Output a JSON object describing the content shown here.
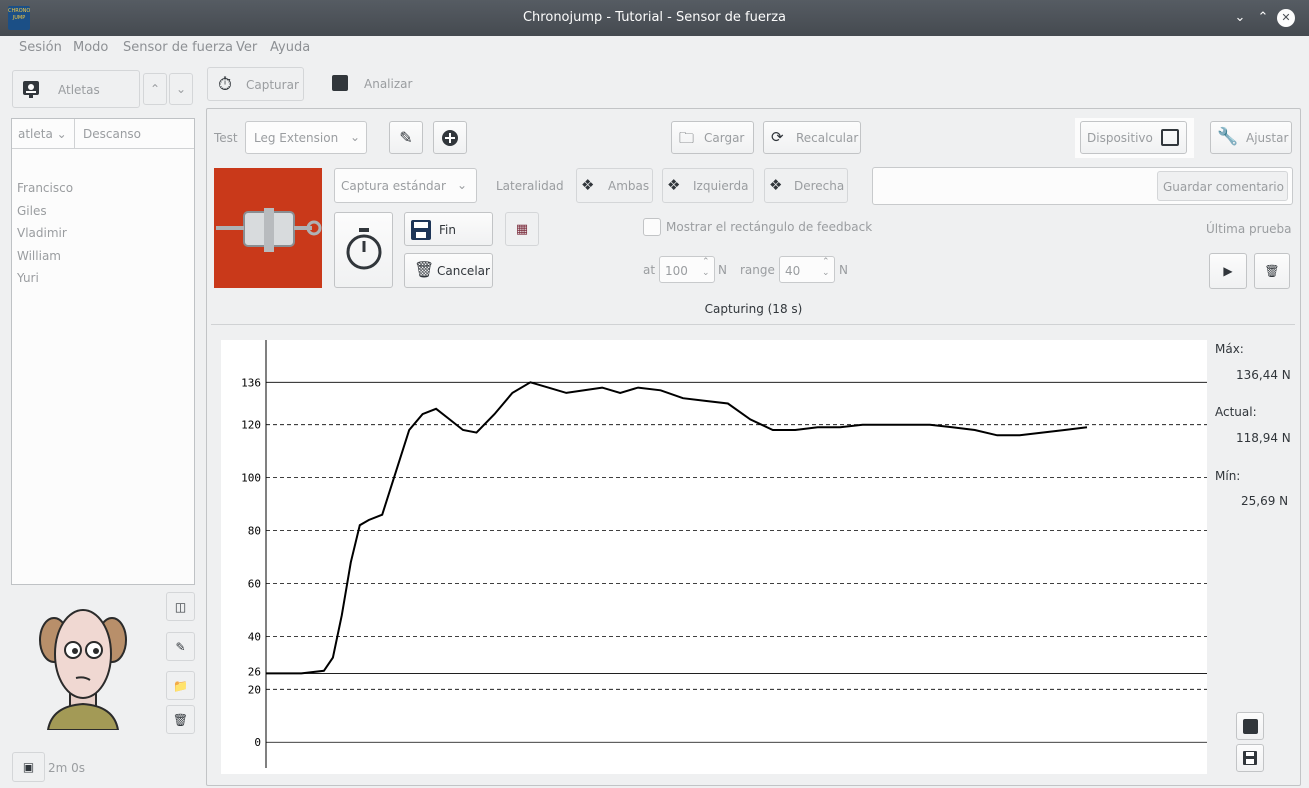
{
  "window": {
    "title": "Chronojump - Tutorial - Sensor de fuerza",
    "app_icon_text": "CHRONO JUMP"
  },
  "menu": [
    "Sesión",
    "Modo",
    "Sensor de fuerza",
    "Ver",
    "Ayuda"
  ],
  "sidebar": {
    "athletes_label": "Atletas",
    "col_athlete": "atleta",
    "col_rest": "Descanso",
    "athletes": [
      "Francisco",
      "Giles",
      "Vladimir",
      "William",
      "Yuri"
    ],
    "rest_time": "2m 0s"
  },
  "tabs": {
    "capture": "Capturar",
    "analyze": "Analizar"
  },
  "toolbar": {
    "test_label": "Test",
    "test_value": "Leg Extension",
    "load": "Cargar",
    "recalc": "Recalcular",
    "device": "Dispositivo",
    "adjust": "Ajustar"
  },
  "controls": {
    "capture_mode": "Captura estándar",
    "laterality_label": "Lateralidad",
    "both": "Ambas",
    "left": "Izquierda",
    "right": "Derecha",
    "comment_placeholder": "",
    "save_comment": "Guardar comentario",
    "finish": "Fin",
    "cancel": "Cancelar",
    "feedback_checkbox": "Mostrar el rectángulo de feedback",
    "at_label": "at",
    "at_value": "100",
    "unit_n": "N",
    "range_label": "range",
    "range_value": "40",
    "last_test": "Última prueba",
    "status": "Capturing (18 s)"
  },
  "stats": {
    "max_label": "Máx:",
    "max_value": "136,44 N",
    "current_label": "Actual:",
    "current_value": "118,94 N",
    "min_label": "Mín:",
    "min_value": "25,69 N"
  },
  "chart_data": {
    "type": "line",
    "title": "",
    "xlabel": "",
    "ylabel": "",
    "ylim": [
      -12,
      152
    ],
    "yticks": [
      0,
      20,
      40,
      60,
      80,
      100,
      120
    ],
    "solid_lines": [
      26,
      136
    ],
    "solid_line_labels": [
      "26",
      "136"
    ],
    "x": [
      0,
      0.5,
      1,
      1.2,
      1.4,
      1.6,
      1.8,
      2.0,
      2.3,
      2.6,
      2.9,
      3.2,
      3.5,
      3.8,
      4.1,
      4.4,
      4.8,
      5.2,
      5.6,
      6.0,
      6.4,
      6.8,
      7.2,
      7.6,
      8.0,
      8.5,
      9.0,
      9.5,
      10.0,
      10.5,
      11.0,
      11.5,
      12.0,
      12.5,
      13.0,
      13.5,
      14.0,
      14.5,
      15.0,
      15.5,
      16.0,
      16.5,
      17.0,
      17.5,
      18.0
    ],
    "series": [
      {
        "values": [
          26,
          26,
          27,
          32,
          48,
          68,
          82,
          84,
          86,
          102,
          118,
          124,
          126,
          122,
          118,
          117,
          124,
          132,
          136,
          134,
          132,
          133,
          134,
          132,
          134,
          133,
          130,
          129,
          128,
          122,
          118,
          118,
          119,
          119,
          120,
          120,
          120,
          120,
          119,
          118,
          116,
          116,
          117,
          118,
          119
        ]
      }
    ]
  }
}
